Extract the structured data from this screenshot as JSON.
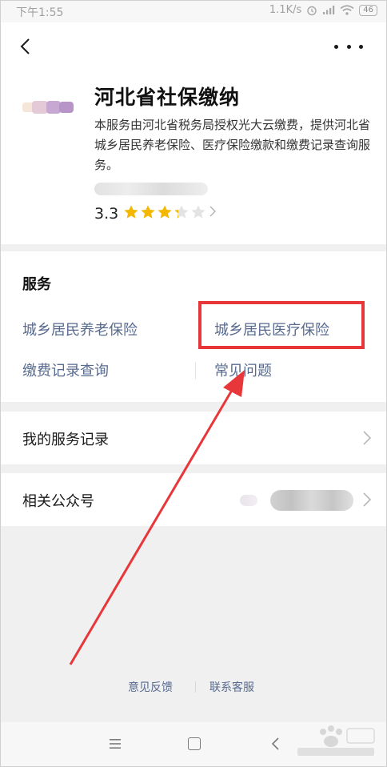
{
  "status_bar": {
    "time": "下午1:55",
    "network_speed": "1.1K/s",
    "battery": "46"
  },
  "app": {
    "title": "河北省社保缴纳",
    "description": "本服务由河北省税务局授权光大云缴费，提供河北省城乡居民养老保险、医疗保险缴款和缴费记录查询服务。",
    "rating": "3.3",
    "rating_value": 3.3,
    "rating_max": 5
  },
  "services": {
    "title": "服务",
    "items": [
      {
        "label": "城乡居民养老保险"
      },
      {
        "label": "城乡居民医疗保险"
      },
      {
        "label": "缴费记录查询"
      },
      {
        "label": "常见问题"
      }
    ]
  },
  "rows": {
    "service_records": "我的服务记录",
    "related_accounts": "相关公众号"
  },
  "footer": {
    "feedback": "意见反馈",
    "contact": "联系客服"
  },
  "colors": {
    "link": "#586b8f",
    "highlight": "#e8373b",
    "star": "#f5b800",
    "background": "#f0f0f0"
  },
  "icons": {
    "back": "chevron-left-icon",
    "more": "more-dots-icon",
    "row_chevron": "chevron-right-icon",
    "nav_menu": "menu-icon",
    "nav_home": "home-square-icon",
    "nav_back": "back-triangle-icon"
  }
}
